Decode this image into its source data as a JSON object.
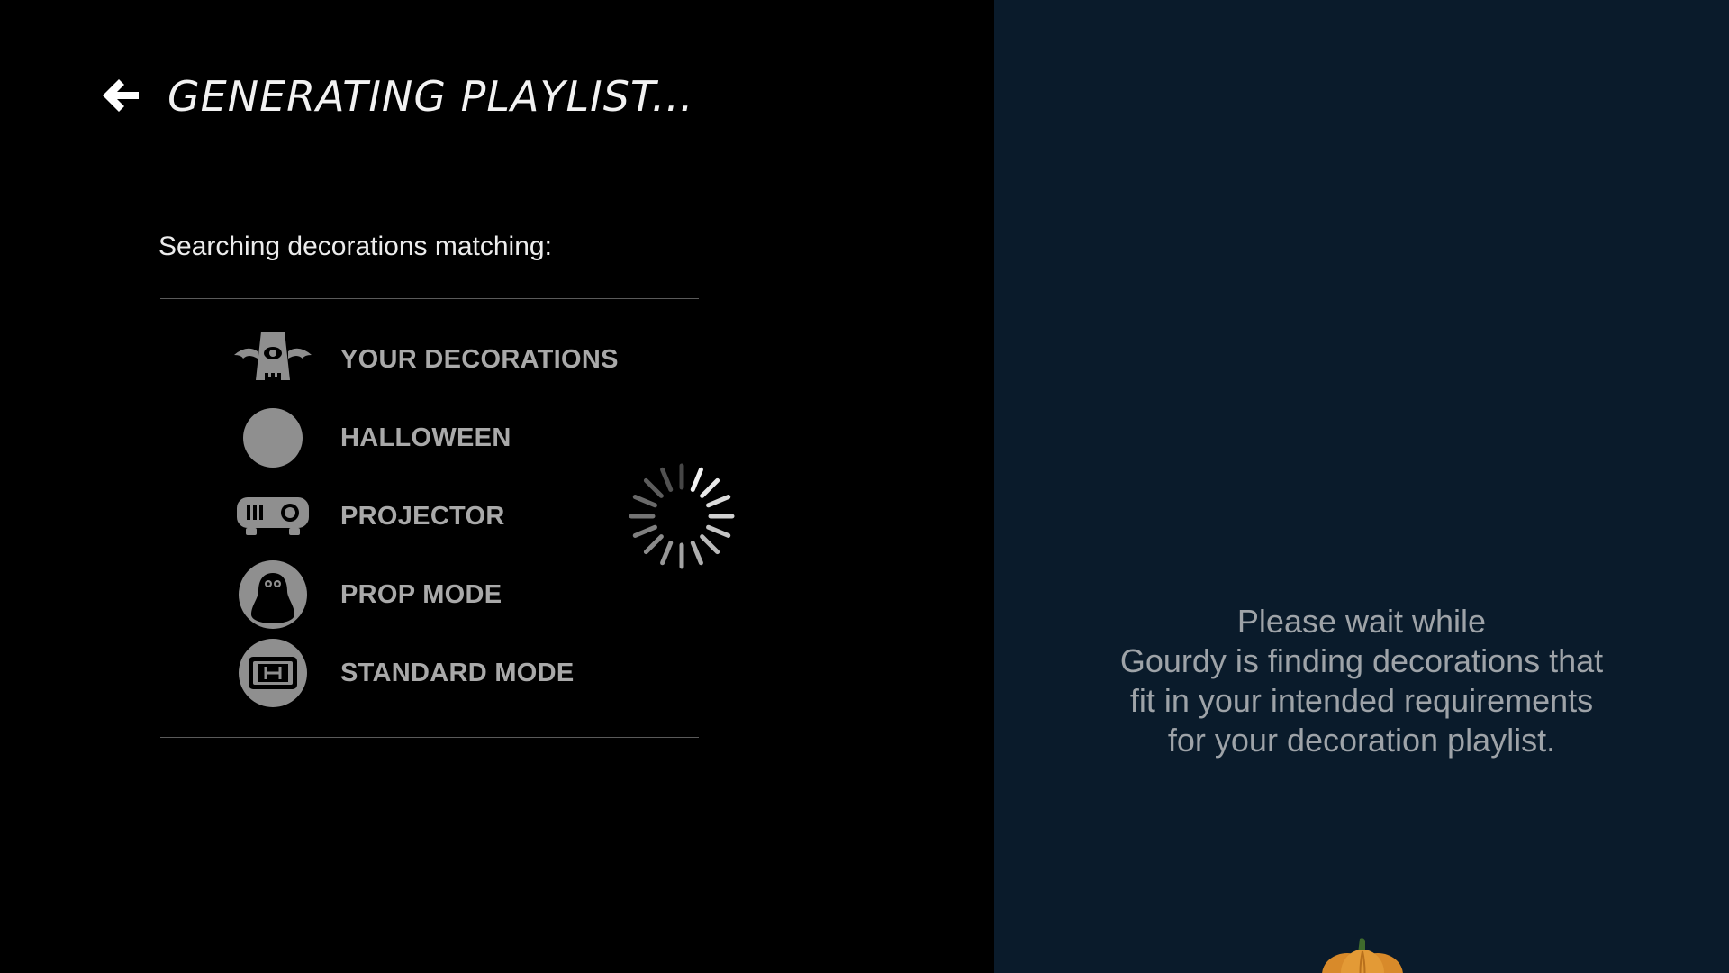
{
  "header": {
    "title": "GENERATING PLAYLIST...",
    "back_icon": "arrow-left-icon"
  },
  "search": {
    "subtitle": "Searching decorations matching:",
    "filters": [
      {
        "label": "YOUR DECORATIONS",
        "icon": "bat-monster-icon"
      },
      {
        "label": "HALLOWEEN",
        "icon": "circle-icon"
      },
      {
        "label": "PROJECTOR",
        "icon": "projector-icon"
      },
      {
        "label": "PROP MODE",
        "icon": "ghost-icon"
      },
      {
        "label": "STANDARD MODE",
        "icon": "h-mode-icon"
      }
    ],
    "loading_icon": "spinner-icon"
  },
  "side_panel": {
    "message_lines": [
      "Please wait while",
      "Gourdy is finding decorations that",
      "fit in your intended requirements",
      "for your decoration playlist."
    ],
    "mascot_icon": "pumpkin-icon"
  },
  "colors": {
    "left_background": "#000000",
    "right_background": "#0a1b2b",
    "label_gray": "#a9a9a9",
    "icon_gray": "#8f8f8f"
  }
}
